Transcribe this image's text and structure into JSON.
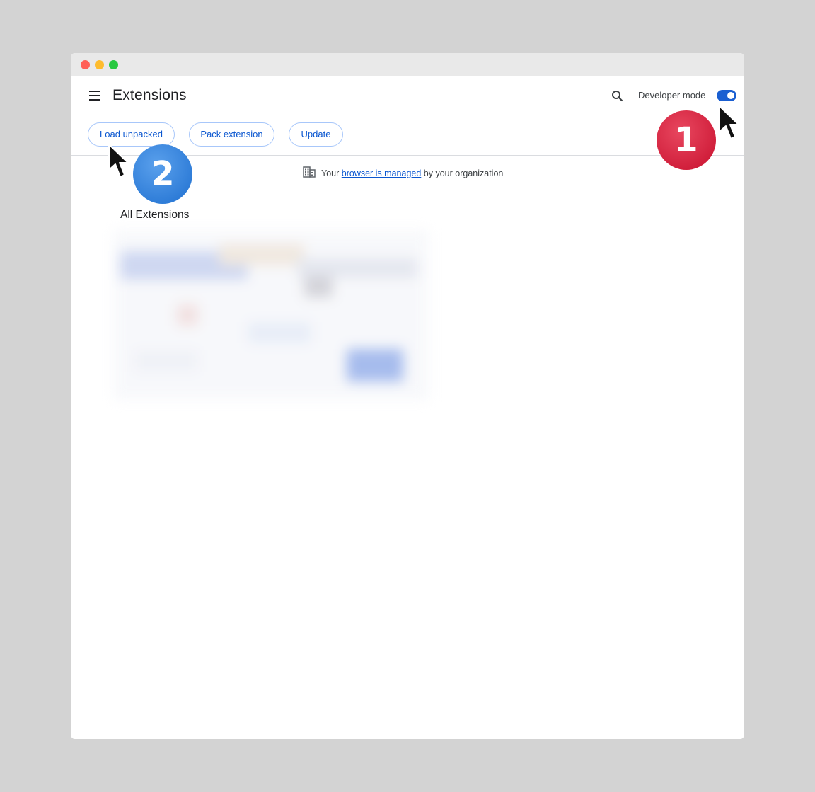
{
  "page": {
    "title": "Extensions",
    "developer_mode_label": "Developer mode",
    "developer_mode_on": true
  },
  "toolbar": {
    "load_unpacked": "Load unpacked",
    "pack_extension": "Pack extension",
    "update": "Update"
  },
  "managed_notice": {
    "prefix": "Your",
    "link": "browser is managed",
    "suffix": "by your organization"
  },
  "section": {
    "title": "All Extensions"
  },
  "annotations": {
    "step1": "1",
    "step2": "2"
  },
  "colors": {
    "accent": "#0b57d0",
    "toggle_on": "#1a5fd1",
    "badge_1": "#c8102e",
    "badge_2": "#1e6fd0"
  }
}
